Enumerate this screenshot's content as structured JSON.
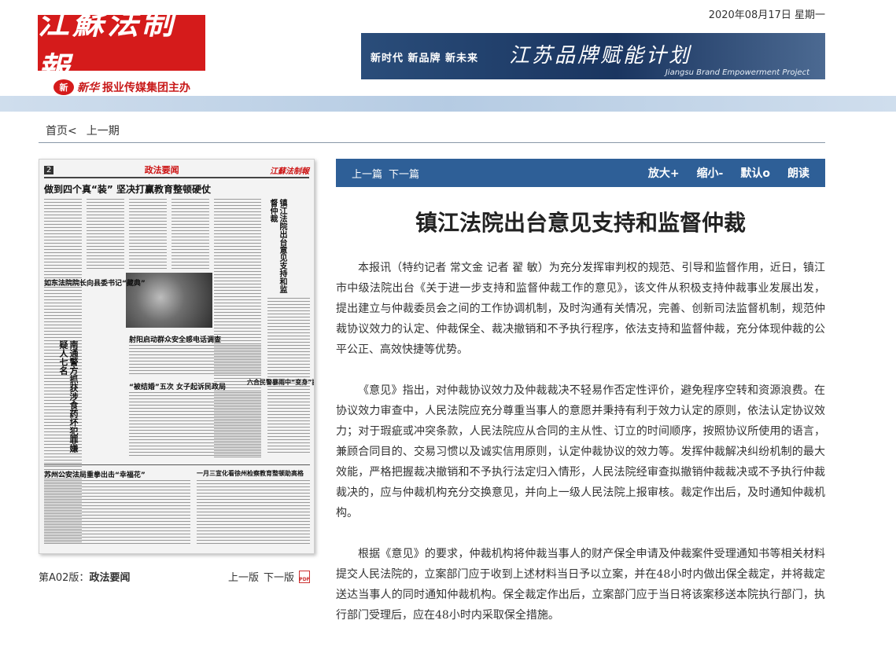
{
  "header": {
    "logo_text": "江蘇法制報",
    "sponsor_mark": "新",
    "sponsor_brand": "新华",
    "sponsor_text": "报业传媒集团主办",
    "date": "2020年08月17日  星期一",
    "banner": {
      "slogan": "新时代  新品牌  新未来",
      "title": "江苏品牌赋能计划",
      "subtitle": "Jiangsu Brand Empowerment Project"
    }
  },
  "nav": {
    "home": "首页<",
    "prev_issue": "上一期"
  },
  "paper": {
    "page_num": "2",
    "section": "政法要闻",
    "logo": "江蘇法制報",
    "headline": "做到四个真“装”  坚决打赢教育整顿硬仗",
    "side_headline": "镇江法院出台意见支持和监督仲裁",
    "left_vertical": "南通警方抓获涉食药坏犯罪嫌疑人七名",
    "sub_headlines": [
      "如东法院院长向县委书记“藏典”",
      "射阳启动群众安全感电话调查",
      "“被结婚”五次  女子起诉民政局",
      "苏州公安法局重拳出击“幸福花”",
      "一月三宣化看徐州检察教育整顿助高格",
      "六合民警暴雨中“变身”搬运工"
    ]
  },
  "page_caption": {
    "prefix": "第A02版：",
    "section": "政法要闻"
  },
  "page_nav": {
    "prev": "上一版",
    "next": "下一版",
    "pdf": "PDF"
  },
  "toolbar": {
    "prev_article": "上一篇",
    "next_article": "下一篇",
    "zoom_in": "放大+",
    "zoom_out": "缩小-",
    "default": "默认o",
    "read_aloud": "朗读"
  },
  "article": {
    "title": "镇江法院出台意见支持和监督仲裁",
    "paragraphs": [
      "本报讯（特约记者 常文金 记者 翟 敏）为充分发挥审判权的规范、引导和监督作用，近日，镇江市中级法院出台《关于进一步支持和监督仲裁工作的意见》，该文件从积极支持仲裁事业发展出发，提出建立与仲裁委员会之间的工作协调机制，及时沟通有关情况，完善、创新司法监督机制，规范仲裁协议效力的认定、仲裁保全、裁决撤销和不予执行程序，依法支持和监督仲裁，充分体现仲裁的公平公正、高效快捷等优势。",
      "《意见》指出，对仲裁协议效力及仲裁裁决不轻易作否定性评价，避免程序空转和资源浪费。在协议效力审查中，人民法院应充分尊重当事人的意愿并秉持有利于效力认定的原则，依法认定协议效力；对于瑕疵或冲突条款，人民法院应从合同的主从性、订立的时间顺序，按照协议所使用的语言，兼顾合同目的、交易习惯以及诚实信用原则，认定仲裁协议的效力等。发挥仲裁解决纠纷机制的最大效能，严格把握裁决撤销和不予执行法定归入情形，人民法院经审查拟撤销仲裁裁决或不予执行仲裁裁决的，应与仲裁机构充分交换意见，并向上一级人民法院上报审核。裁定作出后，及时通知仲裁机构。",
      "根据《意见》的要求，仲裁机构将仲裁当事人的财产保全申请及仲裁案件受理通知书等相关材料提交人民法院的，立案部门应于收到上述材料当日予以立案，并在48小时内做出保全裁定，并将裁定送达当事人的同时通知仲裁机构。保全裁定作出后，立案部门应于当日将该案移送本院执行部门，执行部门受理后，应在48小时内采取保全措施。"
    ]
  }
}
